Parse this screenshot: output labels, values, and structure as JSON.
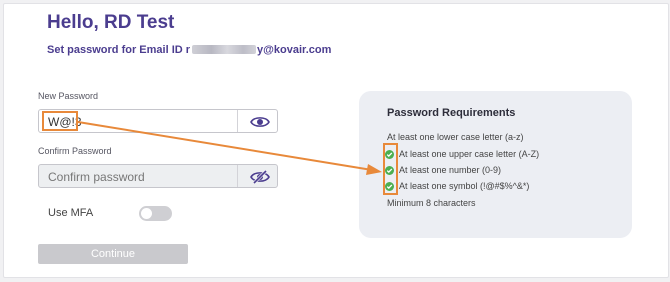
{
  "header": {
    "greeting": "Hello, RD Test",
    "set_password_prefix": "Set password for Email ID r",
    "set_password_suffix": "y@kovair.com"
  },
  "form": {
    "new_password": {
      "label": "New Password",
      "value": "W@!3"
    },
    "confirm_password": {
      "label": "Confirm Password",
      "placeholder": "Confirm password"
    },
    "mfa": {
      "label": "Use MFA",
      "enabled": false
    },
    "continue_label": "Continue"
  },
  "requirements": {
    "title": "Password Requirements",
    "items": [
      {
        "text": "At least one lower case letter (a-z)",
        "met": false
      },
      {
        "text": "At least one upper case letter (A-Z)",
        "met": true
      },
      {
        "text": "At least one number (0-9)",
        "met": true
      },
      {
        "text": "At least one symbol (!@#$%^&*)",
        "met": true
      },
      {
        "text": "Minimum 8 characters",
        "met": false
      }
    ]
  },
  "colors": {
    "brand": "#4b3d8f",
    "success": "#4caf50",
    "annotation": "#e8893a"
  },
  "icons": [
    "eye-icon",
    "eye-slash-icon",
    "check-circle-icon"
  ]
}
